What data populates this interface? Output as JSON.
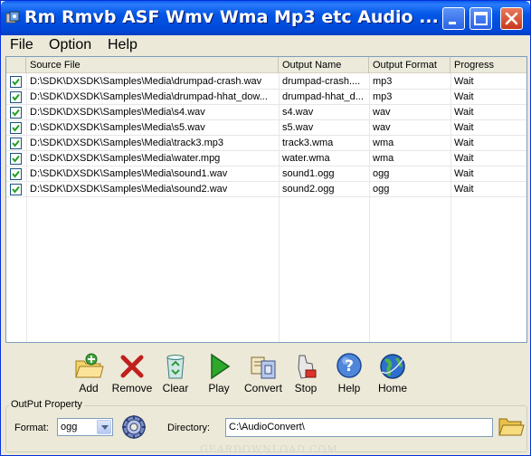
{
  "window": {
    "title": "Rm Rmvb ASF Wmv Wma Mp3 etc Audio ...",
    "colors": {
      "titlebar": "#0356e6",
      "face": "#ece9d8",
      "close": "#d3461f"
    }
  },
  "menu": {
    "items": [
      {
        "label": "File"
      },
      {
        "label": "Option"
      },
      {
        "label": "Help"
      }
    ]
  },
  "list": {
    "columns": [
      {
        "label": "Source File"
      },
      {
        "label": "Output Name"
      },
      {
        "label": "Output Format"
      },
      {
        "label": "Progress"
      }
    ],
    "rows": [
      {
        "checked": true,
        "source": "D:\\SDK\\DXSDK\\Samples\\Media\\drumpad-crash.wav",
        "name": "drumpad-crash....",
        "format": "mp3",
        "progress": "Wait"
      },
      {
        "checked": true,
        "source": "D:\\SDK\\DXSDK\\Samples\\Media\\drumpad-hhat_dow...",
        "name": "drumpad-hhat_d...",
        "format": "mp3",
        "progress": "Wait"
      },
      {
        "checked": true,
        "source": "D:\\SDK\\DXSDK\\Samples\\Media\\s4.wav",
        "name": "s4.wav",
        "format": "wav",
        "progress": "Wait"
      },
      {
        "checked": true,
        "source": "D:\\SDK\\DXSDK\\Samples\\Media\\s5.wav",
        "name": "s5.wav",
        "format": "wav",
        "progress": "Wait"
      },
      {
        "checked": true,
        "source": "D:\\SDK\\DXSDK\\Samples\\Media\\track3.mp3",
        "name": "track3.wma",
        "format": "wma",
        "progress": "Wait"
      },
      {
        "checked": true,
        "source": "D:\\SDK\\DXSDK\\Samples\\Media\\water.mpg",
        "name": "water.wma",
        "format": "wma",
        "progress": "Wait"
      },
      {
        "checked": true,
        "source": "D:\\SDK\\DXSDK\\Samples\\Media\\sound1.wav",
        "name": "sound1.ogg",
        "format": "ogg",
        "progress": "Wait"
      },
      {
        "checked": true,
        "source": "D:\\SDK\\DXSDK\\Samples\\Media\\sound2.wav",
        "name": "sound2.ogg",
        "format": "ogg",
        "progress": "Wait"
      }
    ]
  },
  "toolbar": {
    "buttons": [
      {
        "label": "Add",
        "icon": "add-folder-icon"
      },
      {
        "label": "Remove",
        "icon": "remove-x-icon"
      },
      {
        "label": "Clear",
        "icon": "recycle-bin-icon"
      },
      {
        "label": "Play",
        "icon": "play-icon"
      },
      {
        "label": "Convert",
        "icon": "convert-icon"
      },
      {
        "label": "Stop",
        "icon": "stop-icon"
      },
      {
        "label": "Help",
        "icon": "help-icon"
      },
      {
        "label": "Home",
        "icon": "home-globe-icon"
      }
    ]
  },
  "output": {
    "group_title": "OutPut Property",
    "format_label": "Format:",
    "format_value": "ogg",
    "directory_label": "Directory:",
    "directory_value": "C:\\AudioConvert\\"
  },
  "watermark": "GEARDOWNLOAD.COM"
}
